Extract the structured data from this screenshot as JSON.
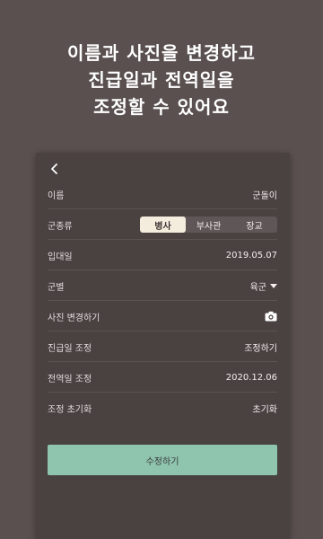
{
  "headline": {
    "line1": "이름과 사진을 변경하고",
    "line2": "진급일과 전역일을",
    "line3": "조정할 수 있어요"
  },
  "form": {
    "name": {
      "label": "이름",
      "value": "군돌이"
    },
    "branch_type": {
      "label": "군종류",
      "options": [
        "병사",
        "부사관",
        "장교"
      ],
      "selected": "병사"
    },
    "enlist_date": {
      "label": "입대일",
      "value": "2019.05.07"
    },
    "army_branch": {
      "label": "군별",
      "value": "육군"
    },
    "photo": {
      "label": "사진 변경하기",
      "icon": "camera-icon"
    },
    "promotion": {
      "label": "진급일 조정",
      "value": "조정하기"
    },
    "discharge": {
      "label": "전역일 조정",
      "value": "2020.12.06"
    },
    "reset": {
      "label": "조정 초기화",
      "value": "초기화"
    },
    "submit_label": "수정하기"
  },
  "colors": {
    "background": "#5a5050",
    "card": "#4a4141",
    "segment_active": "#f4ecdc",
    "submit_button": "#8fc5ae"
  }
}
